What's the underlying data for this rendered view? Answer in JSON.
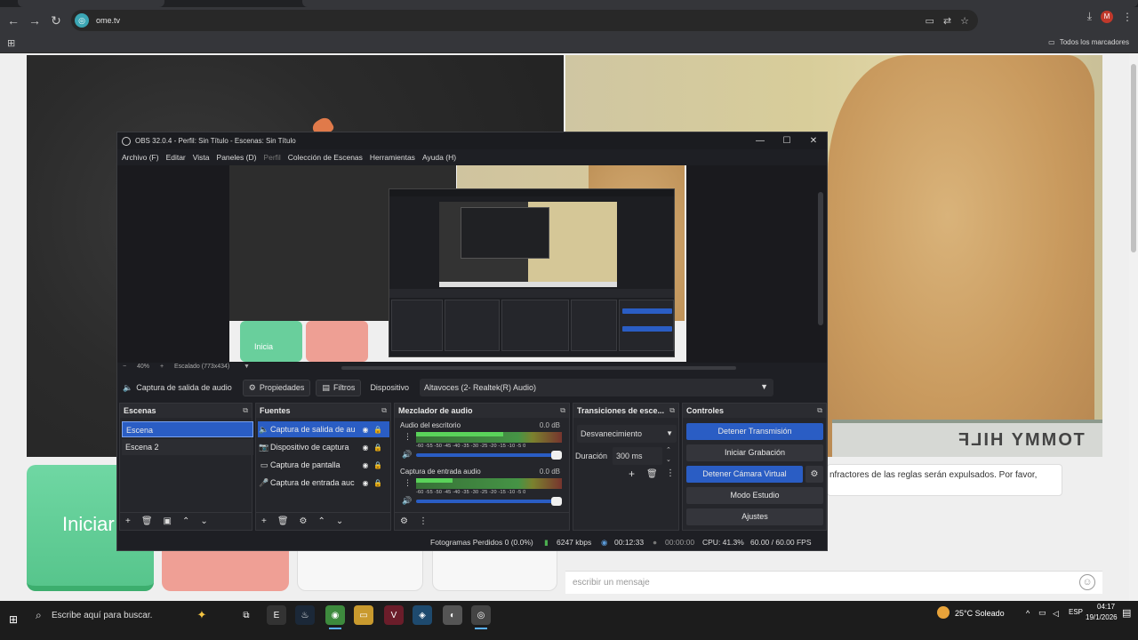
{
  "browser": {
    "url": "ome.tv",
    "all_bookmarks": "Todos los marcadores",
    "avatar": "M"
  },
  "page": {
    "start_tile": "Iniciar",
    "rules_text": "nfractores de las reglas serán expulsados. Por favor,",
    "message_placeholder": "escribir un mensaje",
    "underwear_text": "TOMMY HILF"
  },
  "obs": {
    "title": "OBS 32.0.4 - Perfil: Sin Título - Escenas: Sin Título",
    "menu": [
      "Archivo (F)",
      "Editar",
      "Vista",
      "Paneles (D)",
      "Perfil",
      "Colección de Escenas",
      "Herramientas",
      "Ayuda (H)"
    ],
    "zoom": "40%",
    "scaled": "Escalado (773x434)",
    "source_name": "Captura de salida de audio",
    "properties": "Propiedades",
    "filters": "Filtros",
    "device_label": "Dispositivo",
    "device_value": "Altavoces (2- Realtek(R) Audio)",
    "nested_start": "Inicia",
    "docks": {
      "scenes": {
        "title": "Escenas",
        "items": [
          "Escena",
          "Escena 2"
        ]
      },
      "sources": {
        "title": "Fuentes",
        "items": [
          "Captura de salida de au",
          "Dispositivo de captura",
          "Captura de pantalla",
          "Captura de entrada auc"
        ]
      },
      "mixer": {
        "title": "Mezclador de audio",
        "channels": [
          {
            "name": "Audio del escritorio",
            "db": "0.0 dB",
            "level": 0.6
          },
          {
            "name": "Captura de entrada audio",
            "db": "0.0 dB",
            "level": 0.25
          }
        ],
        "scale": "-60 -55 -50 -45 -40 -35 -30 -25 -20 -15 -10 -5 0"
      },
      "transitions": {
        "title": "Transiciones de esce...",
        "type": "Desvanecimiento",
        "duration_label": "Duración",
        "duration_value": "300 ms"
      },
      "controls": {
        "title": "Controles",
        "stop_stream": "Detener Transmisión",
        "start_record": "Iniciar Grabación",
        "stop_vcam": "Detener Cámara Virtual",
        "studio_mode": "Modo Estudio",
        "settings": "Ajustes"
      }
    },
    "status": {
      "dropped": "Fotogramas Perdidos 0 (0.0%)",
      "bitrate": "6247 kbps",
      "stream_time": "00:12:33",
      "rec_time": "00:00:00",
      "cpu": "CPU: 41.3%",
      "fps": "60.00 / 60.00 FPS"
    }
  },
  "taskbar": {
    "search_placeholder": "Escribe aquí para buscar.",
    "weather": "25°C  Soleado",
    "lang": "ESP",
    "time": "04:17",
    "date": "19/1/2026"
  }
}
